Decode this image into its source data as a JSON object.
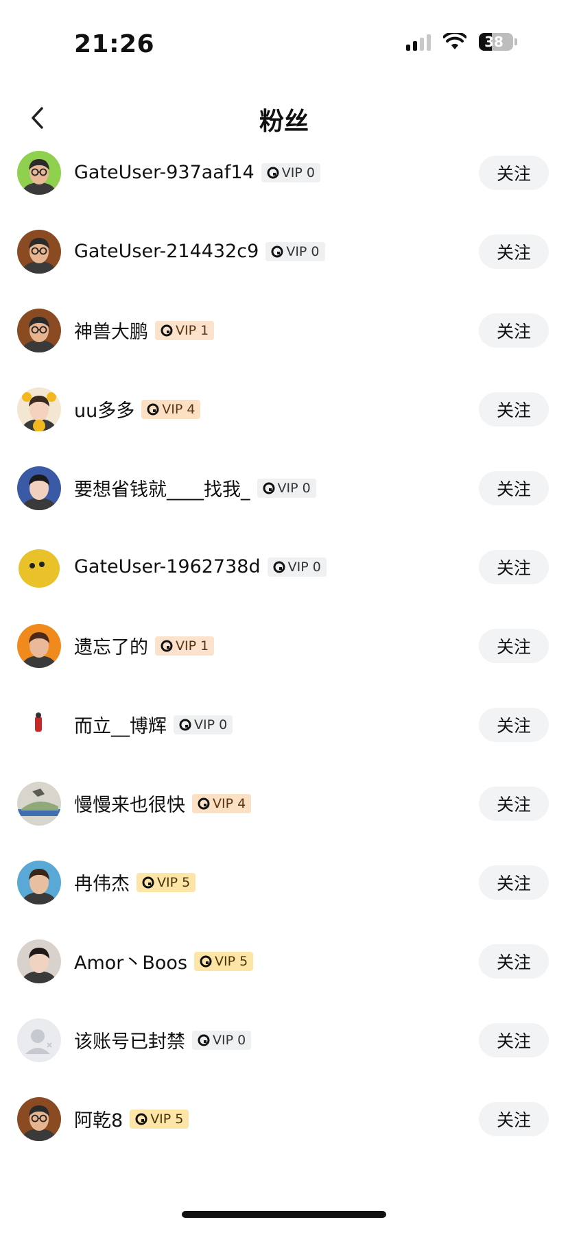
{
  "status": {
    "time": "21:26",
    "battery": "38"
  },
  "nav": {
    "title": "粉丝"
  },
  "colors": {
    "vip0_bg": "#eef0f2",
    "vip1_bg": "#fbe2cc",
    "vip4_bg": "#fbe0c4",
    "vip5_bg": "#fde5a8",
    "button_bg": "#f2f3f5"
  },
  "followers": [
    {
      "name": "GateUser-937aaf14",
      "vip": "VIP 0",
      "avatar": "man-glasses-green-bg",
      "follow_label": "关注"
    },
    {
      "name": "GateUser-214432c9",
      "vip": "VIP 0",
      "avatar": "man-glasses-brown-bg",
      "follow_label": "关注"
    },
    {
      "name": "神兽大鹏",
      "vip": "VIP 1",
      "avatar": "man-glasses-brown-bg",
      "follow_label": "关注"
    },
    {
      "name": "uu多多",
      "vip": "VIP 4",
      "avatar": "girl-sunflowers",
      "follow_label": "关注"
    },
    {
      "name": "要想省钱就____找我_",
      "vip": "VIP 0",
      "avatar": "woman-red-promo",
      "follow_label": "关注"
    },
    {
      "name": "GateUser-1962738d",
      "vip": "VIP 0",
      "avatar": "yellow-blob",
      "follow_label": "关注"
    },
    {
      "name": "遗忘了的",
      "vip": "VIP 1",
      "avatar": "woman-orange-bg",
      "follow_label": "关注"
    },
    {
      "name": "而立__博辉",
      "vip": "VIP 0",
      "avatar": "small-red-figure",
      "follow_label": "关注"
    },
    {
      "name": "慢慢来也很快",
      "vip": "VIP 4",
      "avatar": "landscape-stone",
      "follow_label": "关注"
    },
    {
      "name": "冉伟杰",
      "vip": "VIP 5",
      "avatar": "young-man-blue-bg",
      "follow_label": "关注"
    },
    {
      "name": "Amor丶Boos",
      "vip": "VIP 5",
      "avatar": "woman-peace-sign",
      "follow_label": "关注"
    },
    {
      "name": "该账号已封禁",
      "vip": "VIP 0",
      "avatar": "default-user-icon",
      "follow_label": "关注"
    },
    {
      "name": "阿乾8",
      "vip": "VIP 5",
      "avatar": "man-glasses-brown-bg",
      "follow_label": "关注"
    }
  ]
}
